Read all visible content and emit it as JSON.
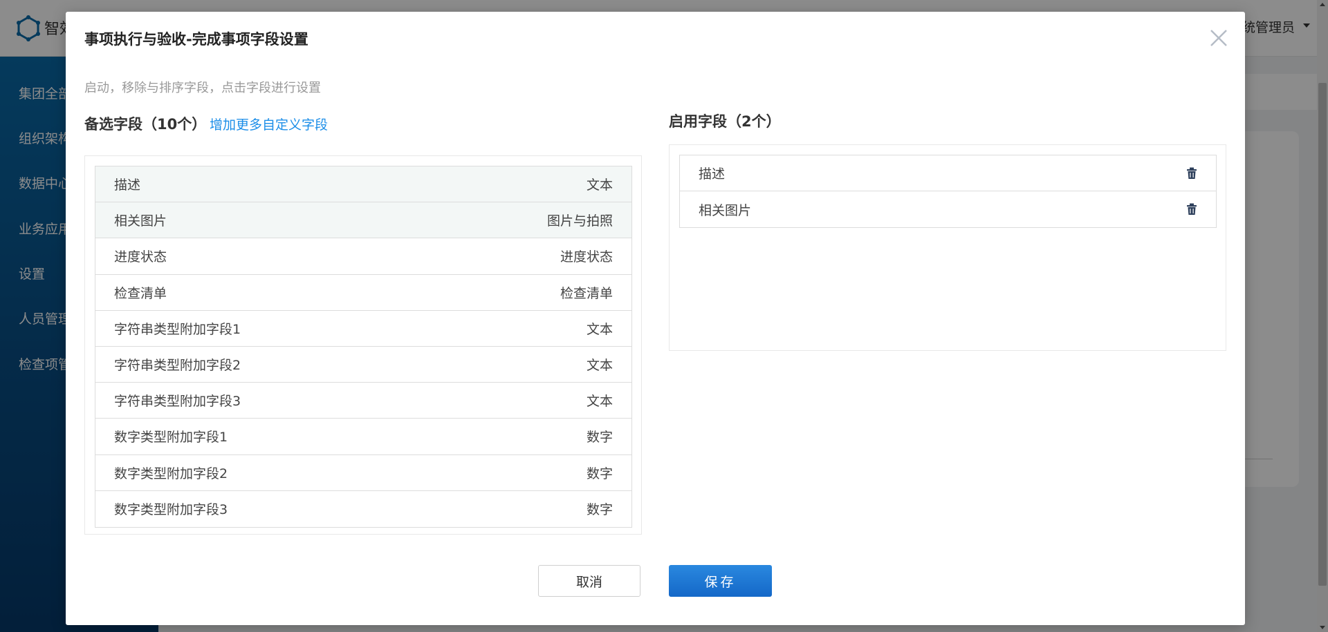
{
  "app": {
    "name": "智效",
    "user": "系统管理员"
  },
  "sidebar": {
    "items": [
      {
        "label": "集团全部"
      },
      {
        "label": "组织架构"
      },
      {
        "label": "数据中心"
      },
      {
        "label": "业务应用"
      },
      {
        "label": "设置"
      },
      {
        "label": "人员管理"
      },
      {
        "label": "检查项管"
      }
    ]
  },
  "modal": {
    "title": "事项执行与验收-完成事项字段设置",
    "hint": "启动，移除与排序字段，点击字段进行设置",
    "available": {
      "title": "备选字段（10个）",
      "add_link": "增加更多自定义字段",
      "fields": [
        {
          "name": "描述",
          "type": "文本",
          "highlighted": true
        },
        {
          "name": "相关图片",
          "type": "图片与拍照",
          "highlighted": true
        },
        {
          "name": "进度状态",
          "type": "进度状态",
          "highlighted": false
        },
        {
          "name": "检查清单",
          "type": "检查清单",
          "highlighted": false
        },
        {
          "name": "字符串类型附加字段1",
          "type": "文本",
          "highlighted": false
        },
        {
          "name": "字符串类型附加字段2",
          "type": "文本",
          "highlighted": false
        },
        {
          "name": "字符串类型附加字段3",
          "type": "文本",
          "highlighted": false
        },
        {
          "name": "数字类型附加字段1",
          "type": "数字",
          "highlighted": false
        },
        {
          "name": "数字类型附加字段2",
          "type": "数字",
          "highlighted": false
        },
        {
          "name": "数字类型附加字段3",
          "type": "数字",
          "highlighted": false
        }
      ]
    },
    "enabled": {
      "title": "启用字段（2个）",
      "fields": [
        {
          "name": "描述",
          "icon": "trash-icon"
        },
        {
          "name": "相关图片",
          "icon": "trash-icon"
        }
      ]
    },
    "buttons": {
      "cancel": "取消",
      "save": "保存"
    }
  },
  "colors": {
    "primary": "#1c8ee8",
    "save_button": "#1a74d4",
    "sidebar": "#0a5a94",
    "highlight_row": "#f3f7f6"
  }
}
